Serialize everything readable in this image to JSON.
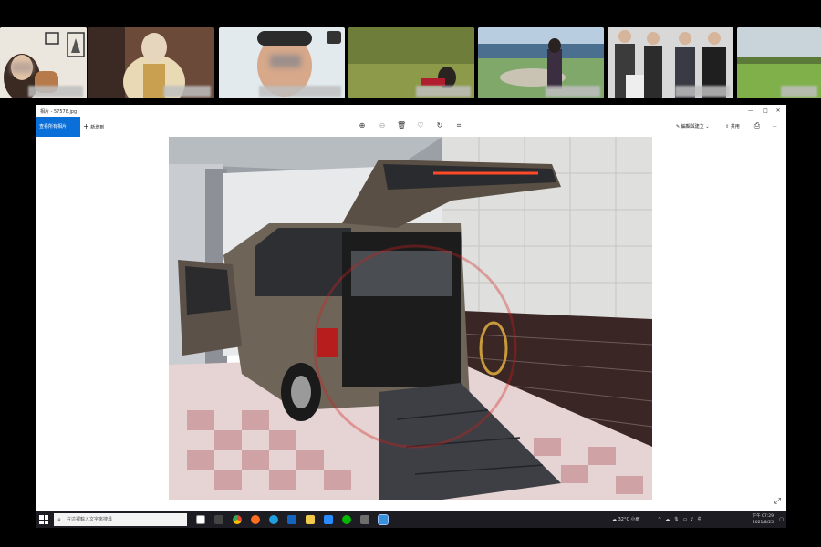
{
  "call_strip": {
    "tile_count": 7
  },
  "window": {
    "title": "相片 - 57578.jpg",
    "controls": [
      "—",
      "□",
      "✕"
    ],
    "toolbar": {
      "primary_label": "查看所有相片",
      "add_label": "新增到",
      "center_icons": [
        "zoom-in-icon",
        "zoom-out-icon",
        "delete-icon",
        "favorite-icon",
        "rotate-icon",
        "crop-icon"
      ],
      "edit_label": "編輯與建立",
      "share_label": "共用",
      "print_icon": "print-icon",
      "more_label": "···"
    }
  },
  "taskbar": {
    "search_placeholder": "在這裡輸入文字來搜尋",
    "weather": "32°C 小雨",
    "time": "下午 07:29",
    "date": "2021/8/25"
  },
  "colors": {
    "accent": "#0a6fd8",
    "taskbar": "#1c1c22"
  }
}
